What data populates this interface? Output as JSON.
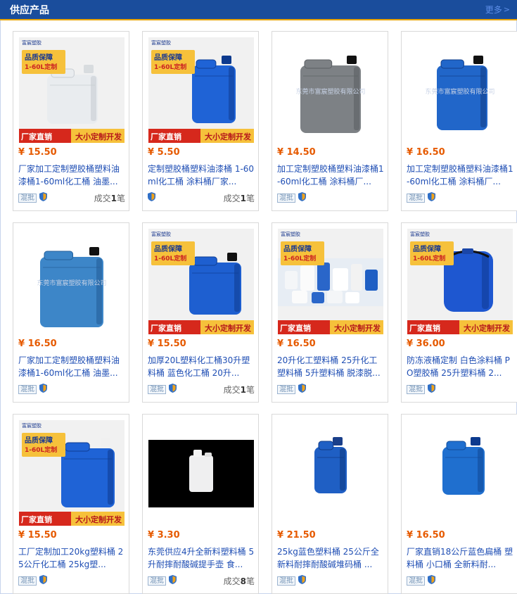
{
  "header": {
    "title": "供应产品",
    "more_label": "更多",
    "more_icon": "chevron-right-icon"
  },
  "promo": {
    "logo": "富宸塑胶",
    "quality": "品质保障",
    "custom": "1-60L定制",
    "direct": "厂家直销",
    "develop": "大小定制开发"
  },
  "watermark": "东莞市富宸塑胶有限公司",
  "meta": {
    "hunpi_label": "混批"
  },
  "colors": {
    "header_bg": "#1a4d9c",
    "price": "#e65a00",
    "title_link": "#1f4eb4",
    "promo_red": "#d6281c",
    "promo_yellow": "#f6c13b"
  },
  "products": [
    {
      "price": "¥ 15.50",
      "title": "厂家加工定制塑胶桶塑料油漆桶1-60ml化工桶 油墨...",
      "has_hunpi": true,
      "deals_prefix": "成交",
      "deals_count": "1",
      "deals_suffix": "笔",
      "image": "promo-white-jerrycan"
    },
    {
      "price": "¥ 5.50",
      "title": "定制塑胶桶塑料油漆桶 1-60ml化工桶 涂料桶厂家...",
      "has_hunpi": false,
      "deals_prefix": "成交",
      "deals_count": "1",
      "deals_suffix": "笔",
      "image": "promo-blue-jerrycan"
    },
    {
      "price": "¥ 14.50",
      "title": "加工定制塑胶桶塑料油漆桶1-60ml化工桶 涂料桶厂...",
      "has_hunpi": true,
      "deals_prefix": "",
      "deals_count": "",
      "deals_suffix": "",
      "image": "gray-jerrycan"
    },
    {
      "price": "¥ 16.50",
      "title": "加工定制塑胶桶塑料油漆桶1-60ml化工桶 涂料桶厂...",
      "has_hunpi": true,
      "deals_prefix": "",
      "deals_count": "",
      "deals_suffix": "",
      "image": "blue-jerrycan-watermark"
    },
    {
      "price": "¥ 16.50",
      "title": "厂家加工定制塑胶桶塑料油漆桶1-60ml化工桶 油墨...",
      "has_hunpi": true,
      "deals_prefix": "",
      "deals_count": "",
      "deals_suffix": "",
      "image": "lightblue-jerrycan-watermark"
    },
    {
      "price": "¥ 15.50",
      "title": "加厚20L塑料化工桶30升塑料桶 蓝色化工桶 20升...",
      "has_hunpi": true,
      "deals_prefix": "成交",
      "deals_count": "1",
      "deals_suffix": "笔",
      "image": "promo-blue-jerrycan-2"
    },
    {
      "price": "¥ 16.50",
      "title": "20升化工塑料桶 25升化工塑料桶 5升塑料桶 脱漆脱...",
      "has_hunpi": true,
      "deals_prefix": "",
      "deals_count": "",
      "deals_suffix": "",
      "image": "promo-assorted-cans"
    },
    {
      "price": "¥ 36.00",
      "title": "防冻液桶定制 白色涂料桶 PO塑胶桶 25升塑料桶 2...",
      "has_hunpi": true,
      "deals_prefix": "",
      "deals_count": "",
      "deals_suffix": "",
      "image": "promo-blue-drum"
    },
    {
      "price": "¥ 15.50",
      "title": "工厂定制加工20kg塑料桶 25公斤化工桶 25kg塑...",
      "has_hunpi": true,
      "deals_prefix": "",
      "deals_count": "",
      "deals_suffix": "",
      "image": "promo-blue-jerrycan-3"
    },
    {
      "price": "¥ 3.30",
      "title": "东莞供应4升全新料塑料桶 5升耐摔耐酸碱提手壶 食...",
      "has_hunpi": true,
      "deals_prefix": "成交",
      "deals_count": "8",
      "deals_suffix": "笔",
      "image": "white-jug-black"
    },
    {
      "price": "¥ 21.50",
      "title": "25kg蓝色塑料桶 25公斤全新料耐摔耐酸碱堆码桶 ...",
      "has_hunpi": true,
      "deals_prefix": "",
      "deals_count": "",
      "deals_suffix": "",
      "image": "small-blue-jerrycan"
    },
    {
      "price": "¥ 16.50",
      "title": "厂家直销18公斤蓝色扁桶 塑料桶 小口桶 全新料耐...",
      "has_hunpi": true,
      "deals_prefix": "",
      "deals_count": "",
      "deals_suffix": "",
      "image": "flat-blue-can"
    }
  ]
}
